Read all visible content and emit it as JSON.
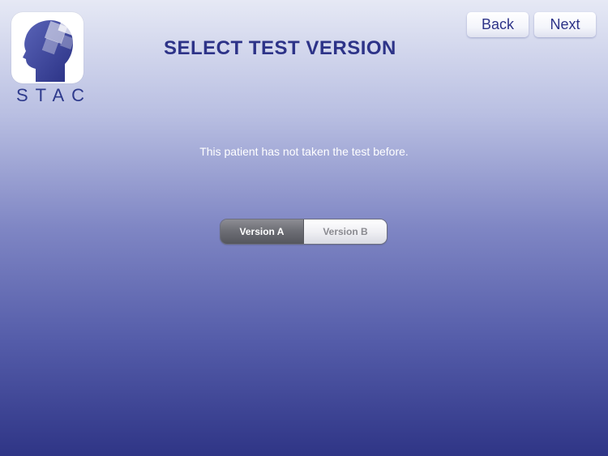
{
  "app": {
    "logo_text": "STAC",
    "title": "SELECT TEST VERSION"
  },
  "nav": {
    "back_label": "Back",
    "next_label": "Next"
  },
  "main": {
    "message": "This patient has not taken the test before.",
    "version_selector": {
      "options": [
        "Version A",
        "Version B"
      ],
      "selected": "Version A"
    }
  },
  "colors": {
    "brand": "#2d3388",
    "gradient_top": "#e6e9f5",
    "gradient_bottom": "#2f3586"
  }
}
